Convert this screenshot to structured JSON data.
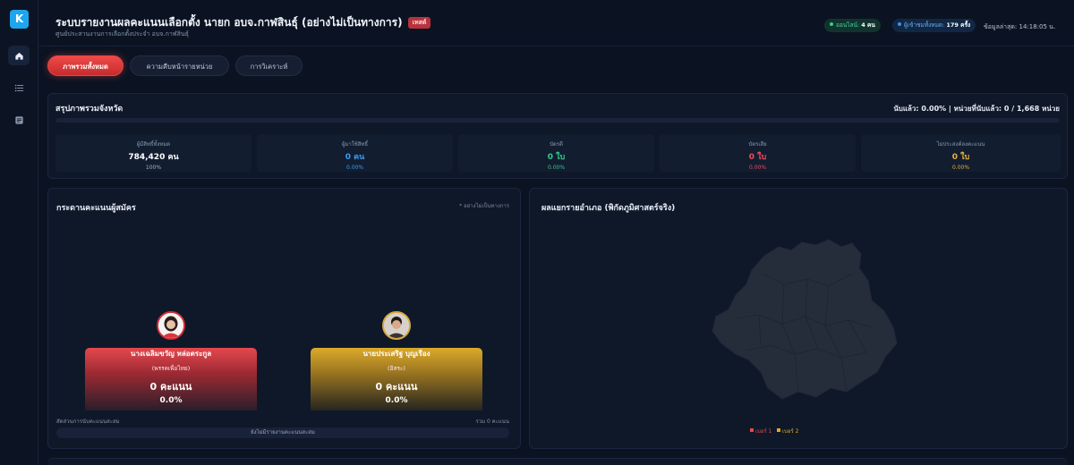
{
  "app": {
    "logo_letter": "K"
  },
  "sidebar": {
    "items": [
      "home-icon",
      "list-icon",
      "report-icon"
    ]
  },
  "header": {
    "title": "ระบบรายงานผลคะแนนเลือกตั้ง นายก อบจ.กาฬสินธุ์ (อย่างไม่เป็นทางการ)",
    "beta": "เทสต์",
    "subtitle": "ศูนย์ประสานงานการเลือกตั้งประจำ อบจ.กาฬสินธุ์",
    "online_label": "ออนไลน์:",
    "online_value": "4 คน",
    "views_label": "ผู้เข้าชมทั้งหมด:",
    "views_value": "179 ครั้ง",
    "updated": "ข้อมูลล่าสุด: 14:18:05 น."
  },
  "tabs": [
    {
      "label": "ภาพรวมทั้งหมด",
      "active": true
    },
    {
      "label": "ความคืบหน้ารายหน่วย",
      "active": false
    },
    {
      "label": "การวิเคราะห์",
      "active": false
    }
  ],
  "summary": {
    "title": "สรุปภาพรวมจังหวัด",
    "counted_text": "นับแล้ว: 0.00% | หน่วยที่นับแล้ว: 0 / 1,668 หน่วย",
    "progress_fraction": 0,
    "stats": [
      {
        "label": "ผู้มีสิทธิ์ทั้งหมด",
        "value": "784,420 คน",
        "pct": "100%",
        "color": "#ffffff",
        "pct_color": "#a9b4c6"
      },
      {
        "label": "ผู้มาใช้สิทธิ์",
        "value": "0 คน",
        "pct": "0.00%",
        "color": "#3b9cf0",
        "pct_color": "#3b9cf0"
      },
      {
        "label": "บัตรดี",
        "value": "0 ใบ",
        "pct": "0.00%",
        "color": "#35c98a",
        "pct_color": "#35c98a"
      },
      {
        "label": "บัตรเสีย",
        "value": "0 ใบ",
        "pct": "0.00%",
        "color": "#ef4e5a",
        "pct_color": "#ef4e5a"
      },
      {
        "label": "ไม่ประสงค์ลงคะแนน",
        "value": "0 ใบ",
        "pct": "0.00%",
        "color": "#e3b13a",
        "pct_color": "#e3b13a"
      }
    ]
  },
  "board": {
    "title": "กระดานคะแนนผู้สมัคร",
    "note": "* อย่างไม่เป็นทางการ",
    "candidates": [
      {
        "name": "นางเฉลิมขวัญ หล่อตระกูล",
        "party": "(พรรคเพื่อไทย)",
        "votes": "0 คะแนน",
        "pct": "0.0%"
      },
      {
        "name": "นายประเสริฐ บุญเรือง",
        "party": "(อิสระ)",
        "votes": "0 คะแนน",
        "pct": "0.0%"
      }
    ],
    "share_label": "สัดส่วนการนับคะแนนสะสม",
    "total_label": "รวม 0 คะแนน",
    "no_data": "ยังไม่มีรายงานคะแนนสะสม"
  },
  "map": {
    "title": "ผลแยกรายอำเภอ (พิกัดภูมิศาสตร์จริง)",
    "legend": [
      {
        "label": "เบอร์ 1",
        "color": "#e5484e"
      },
      {
        "label": "เบอร์ 2",
        "color": "#dcaa2a"
      }
    ]
  }
}
